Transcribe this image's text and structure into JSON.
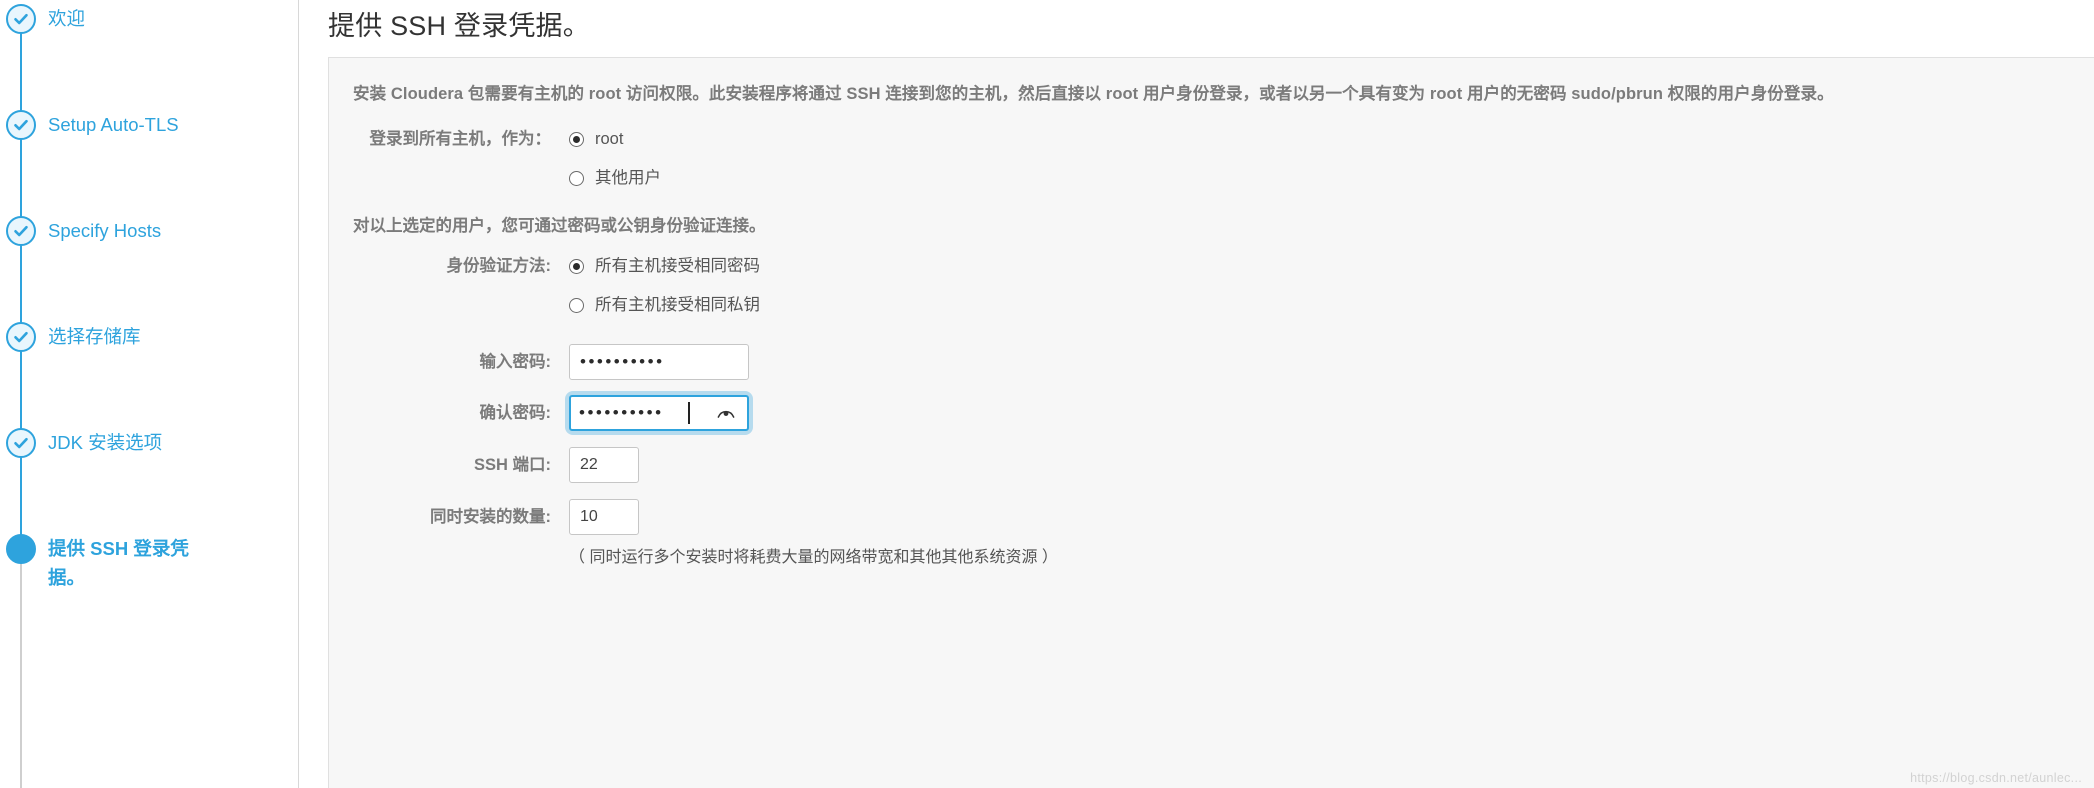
{
  "sidebar": {
    "steps": [
      {
        "label": "欢迎",
        "state": "done"
      },
      {
        "label": "Setup Auto-TLS",
        "state": "done"
      },
      {
        "label": "Specify Hosts",
        "state": "done"
      },
      {
        "label": "选择存储库",
        "state": "done"
      },
      {
        "label": "JDK 安装选项",
        "state": "done"
      },
      {
        "label": "提供 SSH 登录凭据。",
        "state": "current"
      }
    ]
  },
  "main": {
    "title": "提供 SSH 登录凭据。",
    "intro": "安装 Cloudera 包需要有主机的 root 访问权限。此安装程序将通过 SSH 连接到您的主机，然后直接以 root 用户身份登录，或者以另一个具有变为 root 用户的无密码 sudo/pbrun 权限的用户身份登录。",
    "login_as": {
      "label": "登录到所有主机，作为：",
      "options": [
        {
          "text": "root",
          "checked": true
        },
        {
          "text": "其他用户",
          "checked": false
        }
      ]
    },
    "auth_section_head": "对以上选定的用户，您可通过密码或公钥身份验证连接。",
    "auth_method": {
      "label": "身份验证方法:",
      "options": [
        {
          "text": "所有主机接受相同密码",
          "checked": true
        },
        {
          "text": "所有主机接受相同私钥",
          "checked": false
        }
      ]
    },
    "password": {
      "label": "输入密码:",
      "value": "••••••••••"
    },
    "confirm_password": {
      "label": "确认密码:",
      "value": "••••••••••",
      "reveal_icon": "eye-icon"
    },
    "ssh_port": {
      "label": "SSH 端口:",
      "value": "22"
    },
    "concurrent": {
      "label": "同时安装的数量:",
      "value": "10",
      "hint": "（ 同时运行多个安装时将耗费大量的网络带宽和其他其他系统资源 ）"
    }
  },
  "watermark": "https://blog.csdn.net/aunlec...",
  "colors": {
    "accent": "#2ea3dd",
    "step_done_fill": "#e9f6fd",
    "panel_bg": "#f7f7f7",
    "label_text": "#7b7b7b",
    "title_text": "#333333"
  }
}
